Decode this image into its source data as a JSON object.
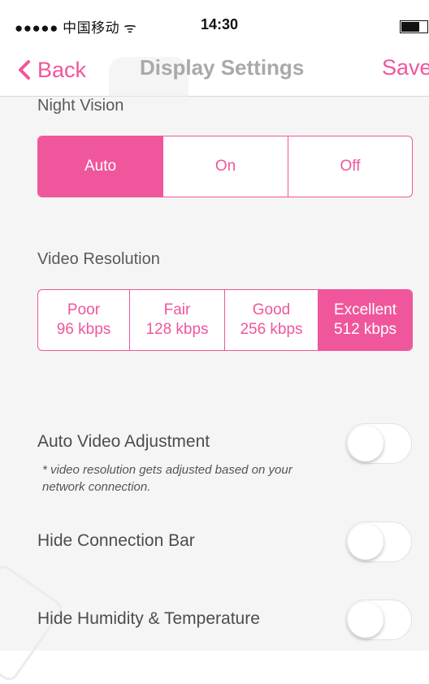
{
  "status_bar": {
    "carrier": "●●●●● 中国移动 ᯤ",
    "time": "14:30"
  },
  "nav": {
    "back_label": "Back",
    "title": "Display Settings",
    "save_label": "Save"
  },
  "night_vision": {
    "label": "Night Vision",
    "options": [
      "Auto",
      "On",
      "Off"
    ],
    "selected": "Auto"
  },
  "video_resolution": {
    "label": "Video Resolution",
    "options": [
      {
        "name": "Poor",
        "rate": "96 kbps"
      },
      {
        "name": "Fair",
        "rate": "128 kbps"
      },
      {
        "name": "Good",
        "rate": "256 kbps"
      },
      {
        "name": "Excellent",
        "rate": "512 kbps"
      }
    ],
    "selected": "Excellent"
  },
  "toggles": [
    {
      "label": "Auto Video Adjustment",
      "note": "* video resolution gets adjusted based on your network connection.",
      "on": false
    },
    {
      "label": "Hide Connection Bar",
      "on": false
    },
    {
      "label": "Hide Humidity & Temperature",
      "on": false
    }
  ],
  "colors": {
    "accent": "#f0569c",
    "background": "#f5f5f5"
  }
}
